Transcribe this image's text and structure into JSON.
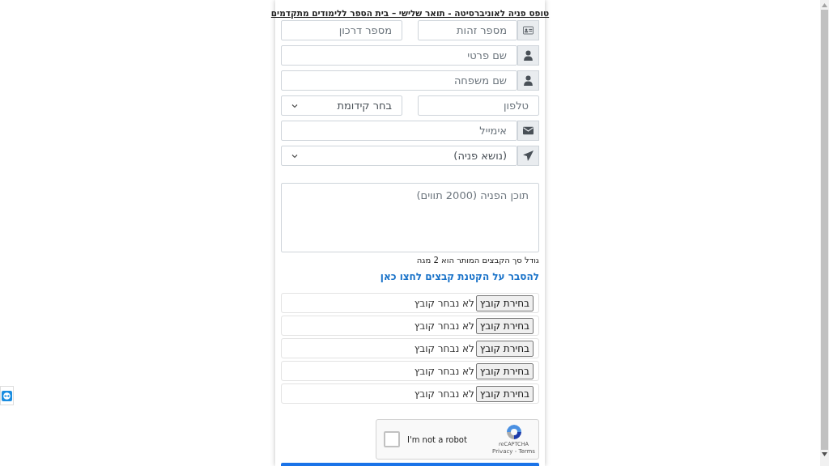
{
  "form": {
    "title": "טופס פניה לאוניברסיטה - תואר שלישי – בית הספר ללימודים מתקדמים",
    "rows": [
      {
        "kind": "id",
        "fields": [
          {
            "kind": "input",
            "placeholder": "מספר זהות"
          },
          {
            "kind": "input",
            "placeholder": "מספר דרכון"
          }
        ]
      },
      {
        "kind": "person",
        "fields": [
          {
            "kind": "input",
            "placeholder": "שם פרטי"
          }
        ]
      },
      {
        "kind": "person",
        "fields": [
          {
            "kind": "input",
            "placeholder": "שם משפחה"
          }
        ]
      },
      {
        "kind": "plain",
        "fields": [
          {
            "kind": "input",
            "placeholder": "טלפון"
          },
          {
            "kind": "select",
            "value": "בחר קידומת"
          }
        ]
      },
      {
        "kind": "email",
        "fields": [
          {
            "kind": "input",
            "placeholder": "אימייל"
          }
        ]
      },
      {
        "kind": "subject",
        "fields": [
          {
            "kind": "select",
            "value": "(נושא פניה)"
          }
        ]
      }
    ],
    "message": {
      "placeholder": "תוכן הפניה (2000 תווים)"
    },
    "size_note": "גודל סך הקבצים המותר הוא 2 מגה",
    "help_link": "להסבר על הקטנת קבצים לחצו כאן",
    "files": [
      {
        "button": "בחירת קובץ",
        "status": "לא נבחר קובץ"
      },
      {
        "button": "בחירת קובץ",
        "status": "לא נבחר קובץ"
      },
      {
        "button": "בחירת קובץ",
        "status": "לא נבחר קובץ"
      },
      {
        "button": "בחירת קובץ",
        "status": "לא נבחר קובץ"
      },
      {
        "button": "בחירת קובץ",
        "status": "לא נבחר קובץ"
      }
    ],
    "captcha": {
      "label": "I'm not a robot",
      "checked": false,
      "brand": "reCAPTCHA",
      "links": "Privacy - Terms"
    }
  }
}
